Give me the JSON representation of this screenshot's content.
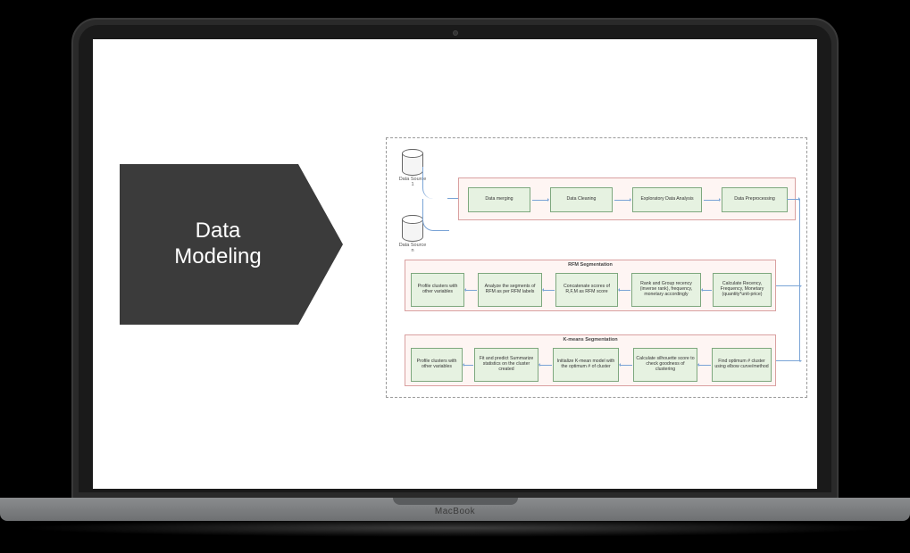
{
  "device": {
    "brand": "MacBook"
  },
  "slide": {
    "title": "Data\nModeling"
  },
  "flow": {
    "sources": [
      {
        "label": "Data Source 1"
      },
      {
        "label": "Data Source n"
      }
    ],
    "lane1": {
      "boxes": [
        "Data merging",
        "Data Cleaning",
        "Exploratory Data Analysis",
        "Data Preprocessing"
      ]
    },
    "lane2": {
      "title": "RFM Segmentation",
      "boxes": [
        "Profile clusters with other variables",
        "Analyze the segments of RFM as per RFM labels",
        "Concatenate scores of R,F,M as RFM score",
        "Rank and Group recency (inverse rank), frequency, monetary accordingly",
        "Calculate Recency, Frequency, Monetary (quantity*unit-price)"
      ]
    },
    "lane3": {
      "title": "K-means Segmentation",
      "boxes": [
        "Profile clusters with other variables",
        "Fit and predict Summarize statistics on the cluster created",
        "Initialize K-mean model with the optimum # of cluster",
        "Calculate silhouette score to check goodness of clustering",
        "Find optimum # cluster using elbow curve/method"
      ]
    }
  }
}
